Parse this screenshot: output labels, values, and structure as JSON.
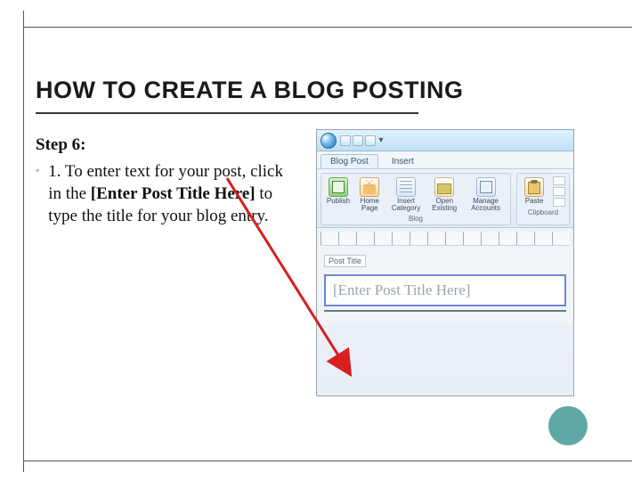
{
  "slide": {
    "title": "HOW TO CREATE A BLOG POSTING",
    "step_label": "Step 6:",
    "bullet": {
      "prefix": "1. To enter text for your post, click in the ",
      "bold": "[Enter Post Title Here]",
      "suffix": " to type the title for your blog entry."
    }
  },
  "app": {
    "tabs": {
      "blog_post": "Blog Post",
      "insert": "Insert"
    },
    "ribbon": {
      "publish": "Publish",
      "home": "Home Page",
      "insert": "Insert Category",
      "open": "Open Existing",
      "manage": "Manage Accounts",
      "paste": "Paste",
      "group_blog": "Blog",
      "group_clip": "Clipboard"
    },
    "doc": {
      "field_label": "Post Title",
      "placeholder": "[Enter Post Title Here]"
    }
  }
}
